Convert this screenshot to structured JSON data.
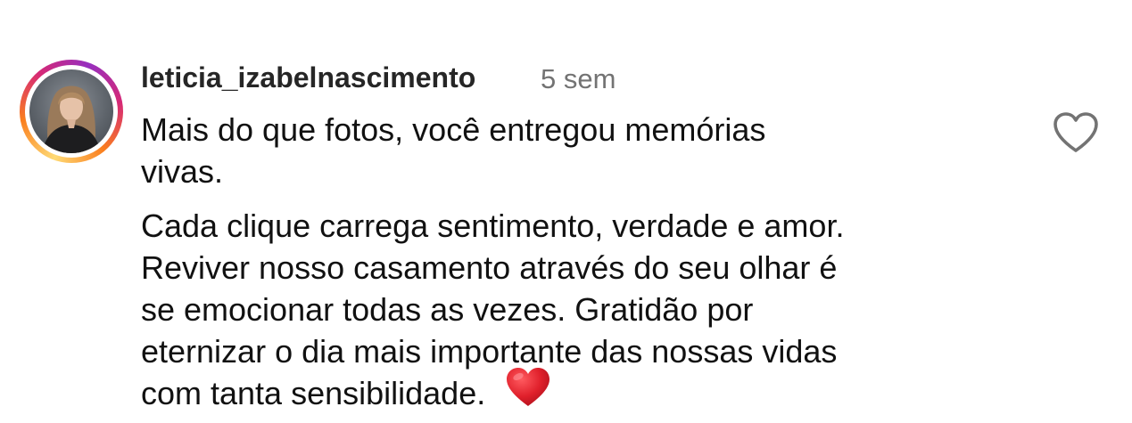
{
  "comment": {
    "username": "leticia_izabelnascimento",
    "timestamp": "5 sem",
    "paragraph1": [
      "Mais do que fotos, você entregou memórias",
      "vivas."
    ],
    "paragraph2": [
      "Cada clique carrega sentimento, verdade e amor.",
      "Reviver nosso casamento através do seu olhar é",
      "se emocionar todas as vezes. Gratidão por",
      "eternizar o dia mais importante das nossas vidas",
      "com tanta sensibilidade."
    ],
    "emoji": "red-heart-emoji",
    "like_icon": "heart-outline-icon",
    "avatar_icon": "profile-photo"
  },
  "colors": {
    "username": "#262626",
    "timestamp": "#737373",
    "text": "#111111",
    "heart_emoji": "#e0202b",
    "like_icon_stroke": "#737373"
  }
}
